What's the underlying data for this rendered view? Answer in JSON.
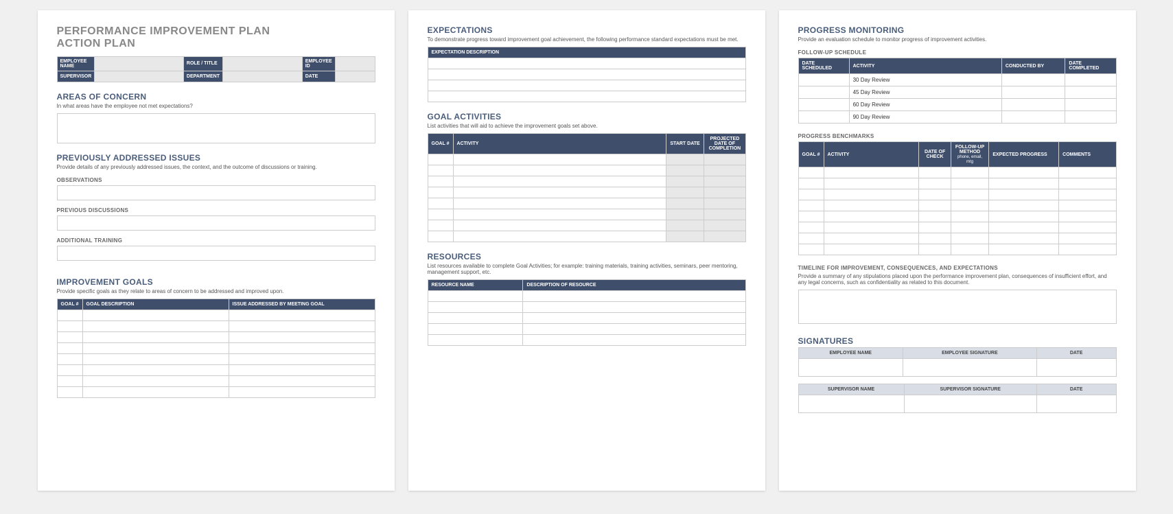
{
  "page1": {
    "title_line1": "PERFORMANCE IMPROVEMENT PLAN",
    "title_line2": "ACTION PLAN",
    "info": {
      "emp_name": "EMPLOYEE NAME",
      "role": "ROLE / TITLE",
      "emp_id": "EMPLOYEE ID",
      "supervisor": "SUPERVISOR",
      "department": "DEPARTMENT",
      "date": "DATE"
    },
    "areas": {
      "title": "AREAS OF CONCERN",
      "sub": "In what areas have the employee not met expectations?"
    },
    "prev": {
      "title": "PREVIOUSLY ADDRESSED ISSUES",
      "sub": "Provide details of any previously addressed issues, the context, and the outcome of discussions or training.",
      "obs": "OBSERVATIONS",
      "disc": "PREVIOUS DISCUSSIONS",
      "train": "ADDITIONAL TRAINING"
    },
    "goals": {
      "title": "IMPROVEMENT GOALS",
      "sub": "Provide specific goals as they relate to areas of concern to be addressed and improved upon.",
      "h1": "GOAL #",
      "h2": "GOAL DESCRIPTION",
      "h3": "ISSUE ADDRESSED BY MEETING GOAL"
    }
  },
  "page2": {
    "expect": {
      "title": "EXPECTATIONS",
      "sub": "To demonstrate progress toward improvement goal achievement, the following performance standard expectations must be met.",
      "h1": "EXPECTATION DESCRIPTION"
    },
    "activities": {
      "title": "GOAL ACTIVITIES",
      "sub": "List activities that will aid to achieve the improvement goals set above.",
      "h1": "GOAL #",
      "h2": "ACTIVITY",
      "h3": "START DATE",
      "h4": "PROJECTED DATE OF COMPLETION"
    },
    "resources": {
      "title": "RESOURCES",
      "sub": "List resources available to complete Goal Activities; for example: training materials, training activities, seminars, peer mentoring, management support, etc.",
      "h1": "RESOURCE NAME",
      "h2": "DESCRIPTION OF RESOURCE"
    }
  },
  "page3": {
    "progress": {
      "title": "PROGRESS MONITORING",
      "sub": "Provide an evaluation schedule to monitor progress of improvement activities."
    },
    "followup": {
      "label": "FOLLOW-UP SCHEDULE",
      "h1": "DATE SCHEDULED",
      "h2": "ACTIVITY",
      "h3": "CONDUCTED BY",
      "h4": "DATE COMPLETED",
      "rows": [
        "30 Day Review",
        "45 Day Review",
        "60 Day Review",
        "90 Day Review"
      ]
    },
    "bench": {
      "label": "PROGRESS BENCHMARKS",
      "h1": "GOAL #",
      "h2": "ACTIVITY",
      "h3": "DATE OF CHECK",
      "h4": "FOLLOW-UP METHOD",
      "h4b": "phone, email, mtg",
      "h5": "EXPECTED PROGRESS",
      "h6": "COMMENTS"
    },
    "timeline": {
      "label": "TIMELINE FOR IMPROVEMENT, CONSEQUENCES, AND EXPECTATIONS",
      "sub": "Provide a summary of any stipulations placed upon the performance improvement plan, consequences of insufficient effort, and any legal concerns, such as confidentiality as related to this document."
    },
    "sig": {
      "title": "SIGNATURES",
      "emp_name": "EMPLOYEE NAME",
      "emp_sig": "EMPLOYEE SIGNATURE",
      "date": "DATE",
      "sup_name": "SUPERVISOR NAME",
      "sup_sig": "SUPERVISOR SIGNATURE"
    }
  }
}
